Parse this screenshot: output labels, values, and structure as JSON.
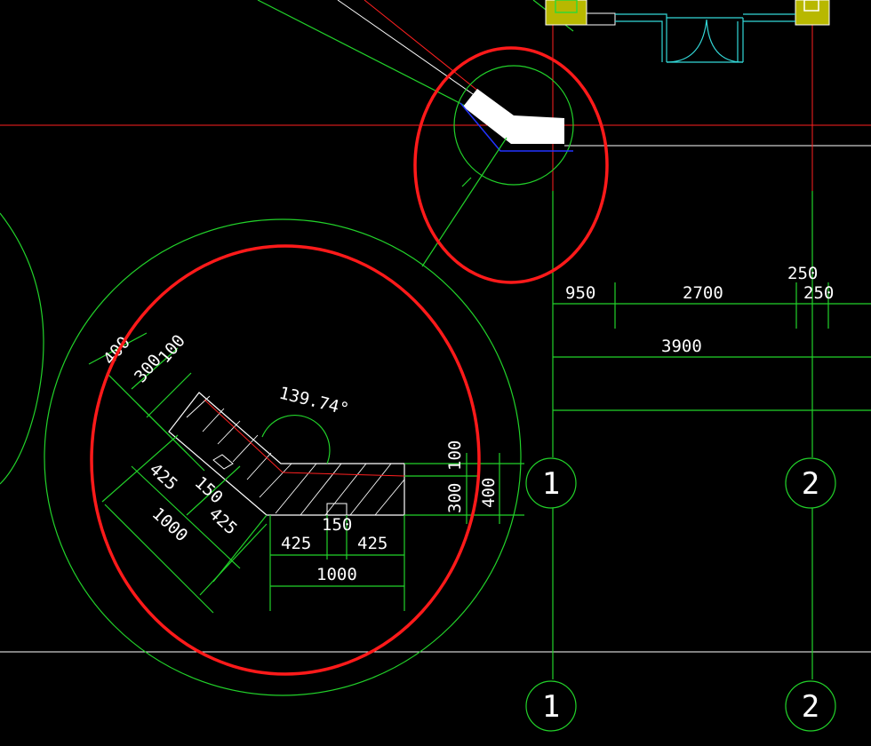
{
  "dimensions": {
    "d950": "950",
    "d2700": "2700",
    "d250_top": "250",
    "d250_right": "250",
    "d3900": "3900",
    "angle": "139.74°",
    "d400_left": "400",
    "d300_left": "300",
    "d100_left": "100",
    "d425_left_a": "425",
    "d150_left": "150",
    "d425_left_b": "425",
    "d1000_left": "1000",
    "d150_bottom": "150",
    "d425_bottom_a": "425",
    "d425_bottom_b": "425",
    "d1000_bottom": "1000",
    "d300_right": "300",
    "d100_right": "100",
    "d400_right": "400"
  },
  "axes": {
    "axis1_upper": "1",
    "axis2_upper": "2",
    "axis1_lower": "1",
    "axis2_lower": "2"
  },
  "colors": {
    "background": "#000000",
    "dimension_lines": "#22d22a",
    "highlight_mark": "#ff1a1a",
    "door_lines": "#33d8d8",
    "column_fill": "#b8b800"
  }
}
